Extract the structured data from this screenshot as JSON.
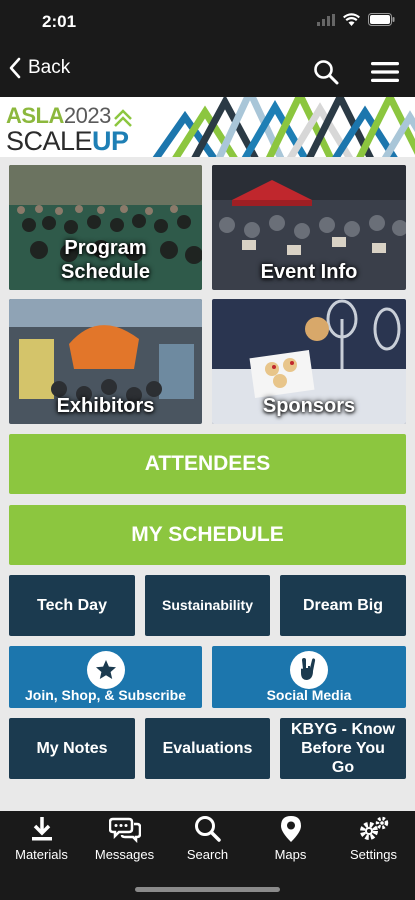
{
  "status": {
    "time": "2:01"
  },
  "nav": {
    "back_label": "Back"
  },
  "banner": {
    "logo_line1_a": "ASLA",
    "logo_line1_b": "2023",
    "logo_line2_a": "SCALE",
    "logo_line2_b": "UP"
  },
  "tiles": {
    "program": "Program Schedule",
    "event": "Event Info",
    "exhibitors": "Exhibitors",
    "sponsors": "Sponsors"
  },
  "buttons": {
    "attendees": "ATTENDEES",
    "my_schedule": "MY SCHEDULE"
  },
  "grid": {
    "tech_day": "Tech Day",
    "sustainability": "Sustainability",
    "dream_big": "Dream Big",
    "join": "Join, Shop, & Subscribe",
    "social": "Social Media",
    "notes": "My Notes",
    "evaluations": "Evaluations",
    "kbyg": "KBYG - Know Before You Go"
  },
  "tabs": [
    "Materials",
    "Messages",
    "Search",
    "Maps",
    "Settings"
  ],
  "colors": {
    "green": "#8cc63f",
    "navy": "#1b3a4f",
    "blue": "#1c76ad",
    "dark": "#1a1a1a"
  }
}
